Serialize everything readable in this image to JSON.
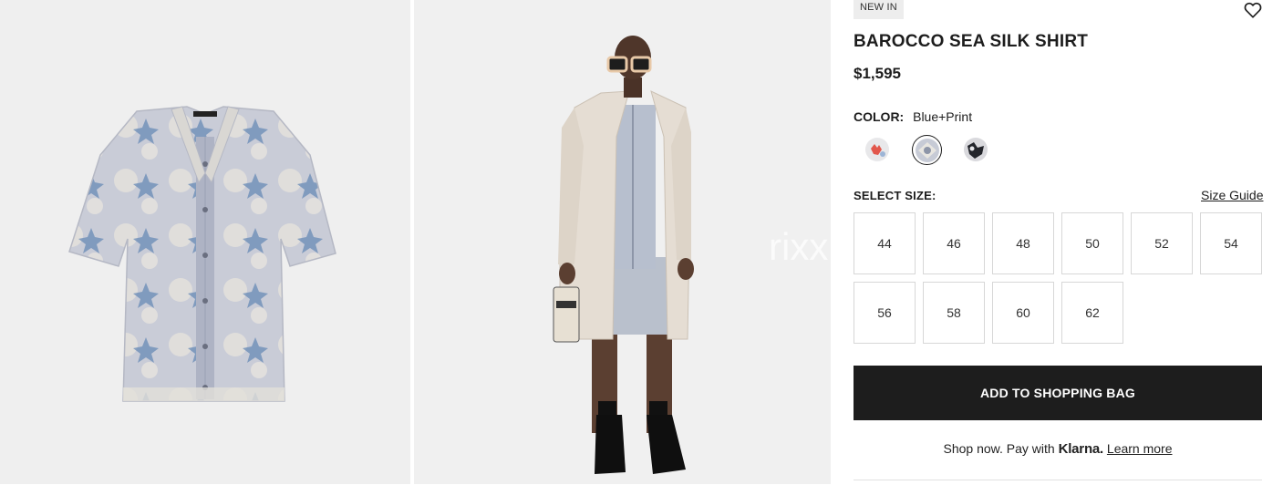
{
  "product": {
    "badge": "NEW IN",
    "title": "BAROCCO SEA SILK SHIRT",
    "price": "$1,595"
  },
  "color": {
    "label": "COLOR:",
    "value": "Blue+Print",
    "swatches": [
      {
        "name": "coral-print",
        "selected": false
      },
      {
        "name": "blue-print",
        "selected": true
      },
      {
        "name": "black-print",
        "selected": false
      }
    ]
  },
  "sizes": {
    "label": "SELECT SIZE:",
    "guide": "Size Guide",
    "options": [
      "44",
      "46",
      "48",
      "50",
      "52",
      "54",
      "56",
      "58",
      "60",
      "62"
    ]
  },
  "cta": {
    "add_label": "ADD TO SHOPPING BAG"
  },
  "klarna": {
    "prefix": "Shop now. Pay with",
    "brand": "Klarna.",
    "link": "Learn more"
  },
  "watermark": "rixx",
  "colors": {
    "button_bg": "#1d1d1d",
    "panel_bg": "#efefef"
  }
}
